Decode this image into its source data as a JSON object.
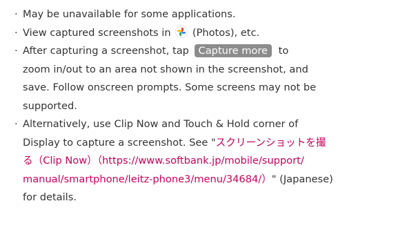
{
  "bullet": "·",
  "notes": [
    {
      "text": "May be unavailable for some applications."
    },
    {
      "before": "View captured screenshots in",
      "icon": "photos-pinwheel-icon",
      "after": " (Photos), etc."
    },
    {
      "before": "After capturing a screenshot, tap",
      "pill": "Capture more",
      "after": " to",
      "lines": [
        "zoom in/out to an area not shown in the screenshot, and",
        "save. Follow onscreen prompts. Some screens may not be",
        "supported."
      ]
    },
    {
      "line1": "Alternatively, use Clip Now and Touch & Hold corner of",
      "line2_before": "Display to capture a screenshot. See \"",
      "link_part1": "スクリーンショットを撮",
      "link_part2": "る（Clip Now）（https://www.softbank.jp/mobile/support/",
      "link_part3": "manual/smartphone/leitz-phone3/menu/34684/）",
      "link_after": "\" (Japanese)",
      "line5": "for details."
    }
  ],
  "colors": {
    "text": "#333333",
    "link": "#c8005a",
    "pill_bg": "#8c8c8c"
  }
}
